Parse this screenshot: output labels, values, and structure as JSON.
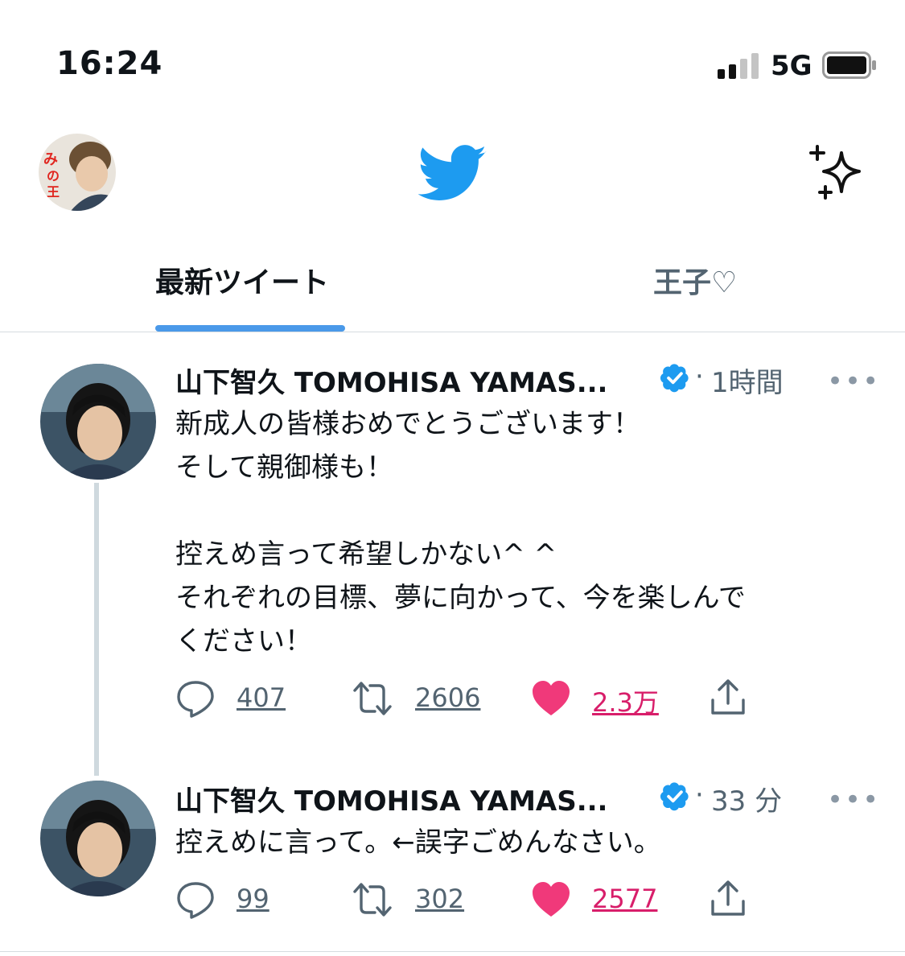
{
  "status_bar": {
    "time": "16:24",
    "network": "5G",
    "signal_icon": "cellular-signal-icon",
    "battery_icon": "battery-icon"
  },
  "header": {
    "avatar_icon": "profile-avatar",
    "logo_icon": "twitter-bird-icon",
    "sparkle_icon": "sparkle-icon",
    "brand_color": "#1d9bf0"
  },
  "tabs": [
    {
      "label": "最新ツイート",
      "active": true
    },
    {
      "label": "王子♡",
      "active": false
    }
  ],
  "tweets": [
    {
      "name": "山下智久 TOMOHISA YAMAS...",
      "dot": "·",
      "time": "1時間",
      "more": "•••",
      "text": "新成人の皆様おめでとうございます！\nそして親御様も！\n\n控えめ言って希望しかない^ ^\nそれぞれの目標、夢に向かって、今を楽しんで\nください！",
      "replies": "407",
      "retweets": "2606",
      "likes": "2.3万"
    },
    {
      "name": "山下智久 TOMOHISA YAMAS...",
      "dot": "·",
      "time": "33 分",
      "more": "•••",
      "text": "控えめに言って。←誤字ごめんなさい。",
      "replies": "99",
      "retweets": "302",
      "likes": "2577"
    }
  ],
  "colors": {
    "accent": "#4a99e9",
    "like": "#f0397a",
    "like_text": "#d81e6a",
    "verified": "#1d9bf0",
    "muted": "#536471"
  }
}
